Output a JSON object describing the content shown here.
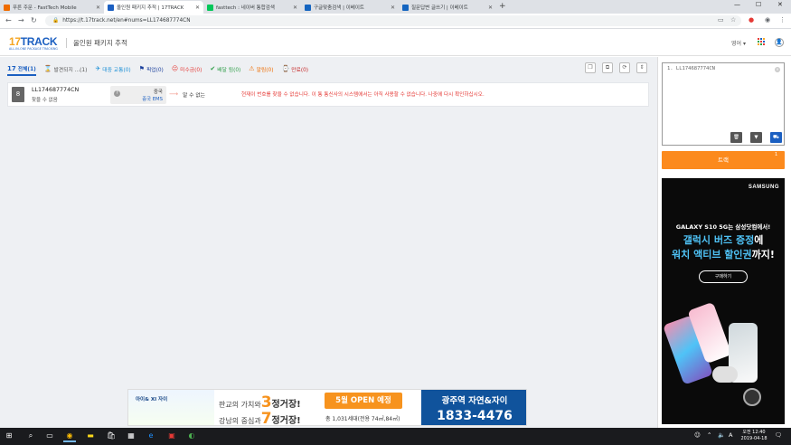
{
  "browser": {
    "tabs": [
      {
        "title": "푸른 주문 - FastTech Mobile",
        "color": "#ef6c00",
        "active": false
      },
      {
        "title": "올인원 패키지 추적 | 17TRACK",
        "color": "#1b5fc1",
        "active": true
      },
      {
        "title": "fasttech : 네이버 통합검색",
        "color": "#03c75a",
        "active": false
      },
      {
        "title": "구글맞춤검색 | 이베이트",
        "color": "#1565c0",
        "active": false
      },
      {
        "title": "질문답변 글쓰기 | 이베이트",
        "color": "#1565c0",
        "active": false
      }
    ],
    "new_tab": "+",
    "url": "https://t.17track.net/en#nums=LL174687774CN"
  },
  "site": {
    "logo_num": "17",
    "logo_text": "TRACK",
    "logo_tagline": "ALL-IN-ONE PACKAGE TRACKING",
    "page_title": "올인원 패키지 추적",
    "language": "영어 ▾"
  },
  "status_tabs": [
    {
      "icon": "17",
      "label": "전체(1)",
      "color": "#1b5fc1",
      "active": true
    },
    {
      "icon": "⌛",
      "label": "발견되지 ...(1)",
      "color": "#555555",
      "active": false
    },
    {
      "icon": "✈",
      "label": "대중 교통(0)",
      "color": "#1b8fd6",
      "active": false
    },
    {
      "icon": "⚑",
      "label": "픽업(0)",
      "color": "#1a3f9c",
      "active": false
    },
    {
      "icon": "☹",
      "label": "미수금(0)",
      "color": "#e53935",
      "active": false
    },
    {
      "icon": "✔",
      "label": "배달 됨(0)",
      "color": "#2e9e48",
      "active": false
    },
    {
      "icon": "⚠",
      "label": "알림(0)",
      "color": "#ef6c00",
      "active": false
    },
    {
      "icon": "⌚",
      "label": "만료(0)",
      "color": "#c62828",
      "active": false
    }
  ],
  "result": {
    "carrier_badge": "8",
    "tracking_number": "LL174687774CN",
    "status": "찾을 수 없음",
    "origin_country": "중국",
    "origin_carrier": "중국 EMS",
    "destination": "알 수 없는",
    "message": "현재이 번호를 찾을 수 없습니다. 이 통 통신사의 시스템에서는 아직 사용할 수 없습니다. 나중에 다시 확인하십시오."
  },
  "panel": {
    "input_value": "1. LL174687774CN",
    "track_label": "트랙",
    "track_badge": "1"
  },
  "samsung_ad": {
    "brand": "SAMSUNG",
    "line1": "GALAXY S10 5G는 삼성닷컴에서!",
    "line2a": "갤럭시 버즈 증정",
    "line2b": "에",
    "line3a": "워치 액티브 할인권",
    "line3b": "까지!",
    "buy_label": "구매하기"
  },
  "banner_ad": {
    "logos": "아이& XI 자이",
    "row1_pre": "판교의 가치와",
    "row1_num": "3",
    "row1_post": "정거장!",
    "row2_pre": "강남의 중심과",
    "row2_num": "7",
    "row2_post": "정거장!",
    "open_label": "5월 OPEN 예정",
    "size_line": "총 1,031세대(전용 74㎡,84㎡)",
    "station": "광주역 자연&자이",
    "phone": "1833-4476"
  },
  "taskbar": {
    "time": "오전 12:40",
    "date": "2019-04-18"
  }
}
